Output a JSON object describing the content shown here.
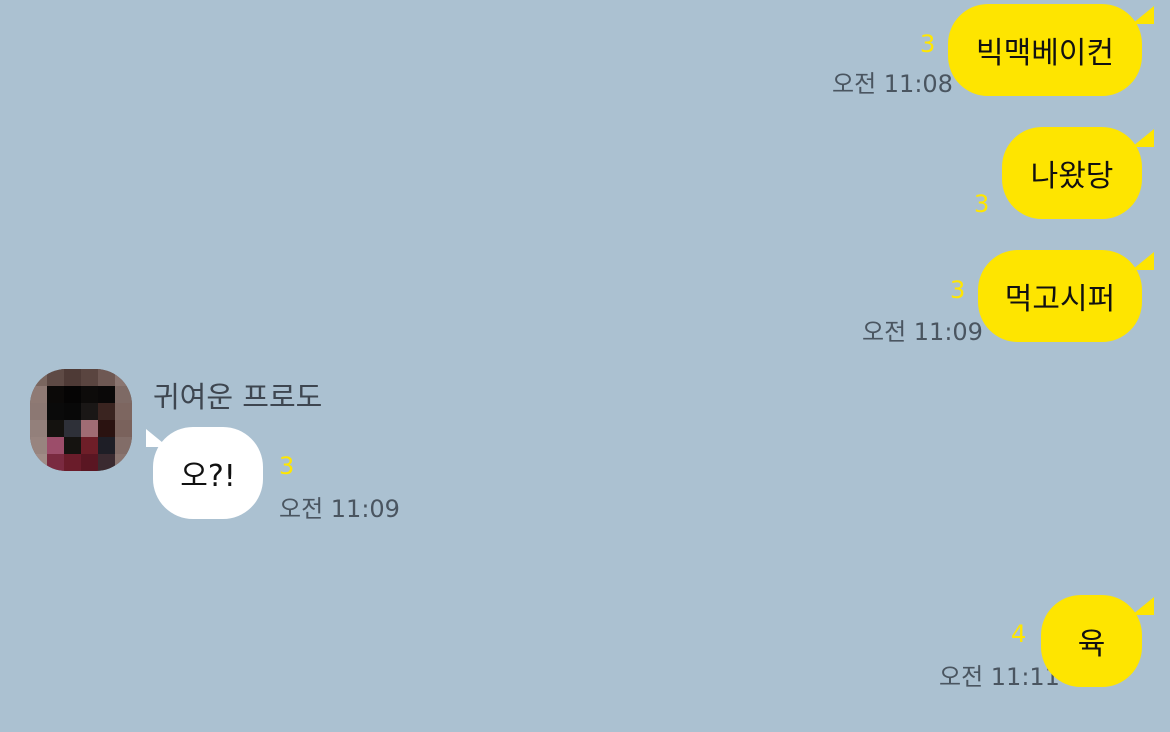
{
  "messages": [
    {
      "side": "mine",
      "text": "빅맥베이컨",
      "unread": "3",
      "time": "오전 11:08"
    },
    {
      "side": "mine",
      "text": "나왔당",
      "unread": "3",
      "time": ""
    },
    {
      "side": "mine",
      "text": "먹고시퍼",
      "unread": "3",
      "time": "오전 11:09"
    },
    {
      "side": "theirs",
      "sender": "귀여운 프로도",
      "text": "오?!",
      "unread": "3",
      "time": "오전 11:09"
    },
    {
      "side": "mine",
      "text": "육",
      "unread": "4",
      "time": "오전 11:11"
    }
  ],
  "colors": {
    "background": "#abc1d1",
    "my_bubble": "#fee500",
    "their_bubble": "#ffffff",
    "unread_count": "#ffe600",
    "timestamp": "#4a5560"
  }
}
